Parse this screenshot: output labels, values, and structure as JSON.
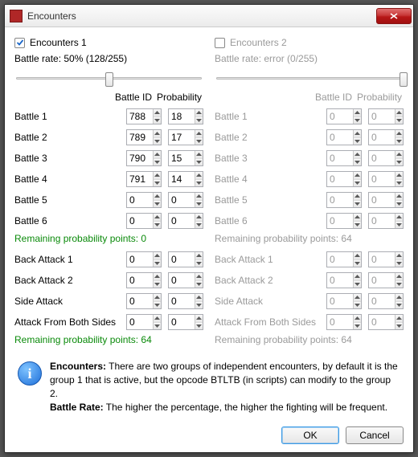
{
  "window": {
    "title": "Encounters"
  },
  "left": {
    "checkbox_label": "Encounters 1",
    "checked": true,
    "rate_text": "Battle rate: 50% (128/255)",
    "slider_percent": 50,
    "headers": {
      "id": "Battle ID",
      "prob": "Probability"
    },
    "battles": [
      {
        "label": "Battle 1",
        "id": "788",
        "prob": "18"
      },
      {
        "label": "Battle 2",
        "id": "789",
        "prob": "17"
      },
      {
        "label": "Battle 3",
        "id": "790",
        "prob": "15"
      },
      {
        "label": "Battle 4",
        "id": "791",
        "prob": "14"
      },
      {
        "label": "Battle 5",
        "id": "0",
        "prob": "0"
      },
      {
        "label": "Battle 6",
        "id": "0",
        "prob": "0"
      }
    ],
    "remaining1": "Remaining probability points: 0",
    "attacks": [
      {
        "label": "Back Attack 1",
        "id": "0",
        "prob": "0"
      },
      {
        "label": "Back Attack 2",
        "id": "0",
        "prob": "0"
      },
      {
        "label": "Side Attack",
        "id": "0",
        "prob": "0"
      },
      {
        "label": "Attack From Both Sides",
        "id": "0",
        "prob": "0"
      }
    ],
    "remaining2": "Remaining probability points: 64"
  },
  "right": {
    "checkbox_label": "Encounters 2",
    "checked": false,
    "rate_text": "Battle rate: error (0/255)",
    "slider_percent": 100,
    "headers": {
      "id": "Battle ID",
      "prob": "Probability"
    },
    "battles": [
      {
        "label": "Battle 1",
        "id": "0",
        "prob": "0"
      },
      {
        "label": "Battle 2",
        "id": "0",
        "prob": "0"
      },
      {
        "label": "Battle 3",
        "id": "0",
        "prob": "0"
      },
      {
        "label": "Battle 4",
        "id": "0",
        "prob": "0"
      },
      {
        "label": "Battle 5",
        "id": "0",
        "prob": "0"
      },
      {
        "label": "Battle 6",
        "id": "0",
        "prob": "0"
      }
    ],
    "remaining1": "Remaining probability points: 64",
    "attacks": [
      {
        "label": "Back Attack 1",
        "id": "0",
        "prob": "0"
      },
      {
        "label": "Back Attack 2",
        "id": "0",
        "prob": "0"
      },
      {
        "label": "Side Attack",
        "id": "0",
        "prob": "0"
      },
      {
        "label": "Attack From Both Sides",
        "id": "0",
        "prob": "0"
      }
    ],
    "remaining2": "Remaining probability points: 64"
  },
  "info": {
    "encounters_label": "Encounters:",
    "encounters_text": " There are two groups of independent encounters, by default it is the group 1 that is active, but the opcode BTLTB (in scripts) can modify to the group 2.",
    "rate_label": "Battle Rate:",
    "rate_text": " The higher the percentage, the higher the fighting will be frequent."
  },
  "buttons": {
    "ok": "OK",
    "cancel": "Cancel"
  }
}
